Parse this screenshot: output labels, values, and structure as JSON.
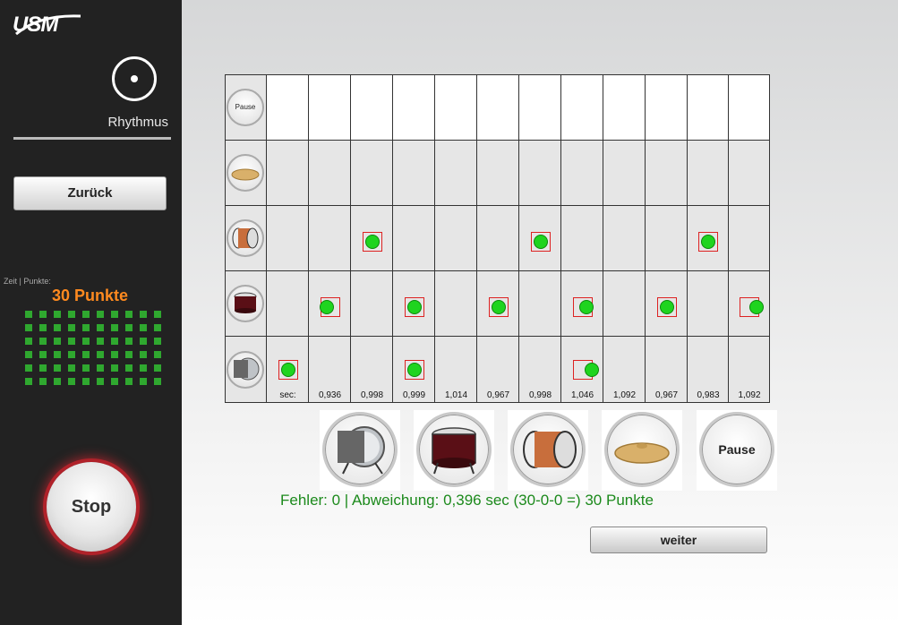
{
  "sidebar": {
    "logo": "USM",
    "mode_label": "Rhythmus",
    "back_label": "Zurück",
    "score_caption": "Zeit | Punkte:",
    "score_value": "30 Punkte",
    "stop_label": "Stop"
  },
  "grid": {
    "pause_label": "Pause",
    "rows": [
      "pause",
      "cymbal",
      "snare",
      "tom",
      "bass-drum"
    ],
    "sec_label": "sec:",
    "times": [
      "0,936",
      "0,998",
      "0,999",
      "1,014",
      "0,967",
      "0,998",
      "1,046",
      "1,092",
      "0,967",
      "0,983",
      "1,092"
    ]
  },
  "pads": {
    "pause_label": "Pause"
  },
  "result_text": "Fehler: 0 | Abweichung: 0,396 sec (30-0-0 =) 30 Punkte",
  "weiter_label": "weiter",
  "colors": {
    "accent": "#ff8a1f",
    "success": "#1c8a1c",
    "note": "#1fd41f",
    "note_box": "#dd2222",
    "stop_glow": "#b0222a"
  }
}
